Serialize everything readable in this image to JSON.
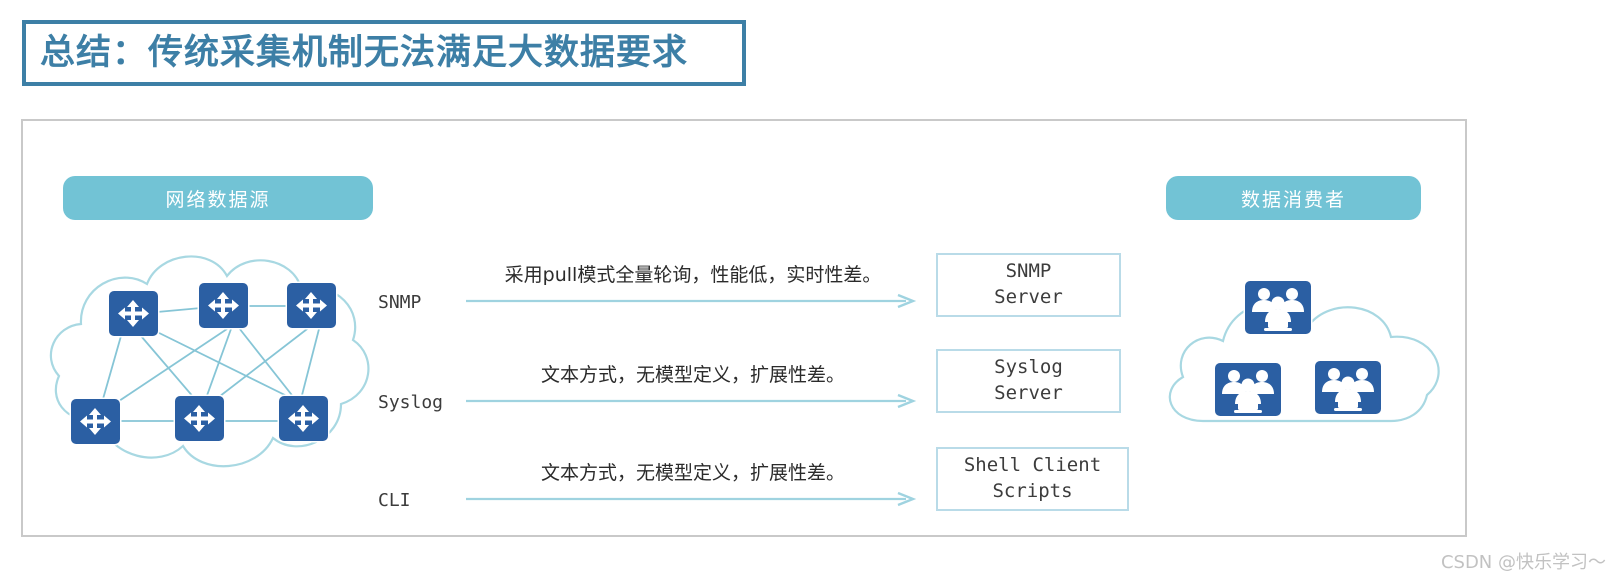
{
  "title": {
    "text": "总结：传统采集机制无法满足大数据要求"
  },
  "colors": {
    "title_accent": "#3d7fa6",
    "pill": "#72c3d5",
    "node_blue": "#2b5fa3",
    "cloud_outline": "#a8d8e2",
    "box_border": "#b9dbe8",
    "frame_border": "#c9c9c9",
    "arrow": "#9fd3e0"
  },
  "diagram": {
    "source_pill_label": "网络数据源",
    "consumer_pill_label": "数据消费者",
    "left_cloud_name": "network-cloud",
    "right_cloud_name": "consumer-cloud",
    "switch_count": 6,
    "user_group_count": 3,
    "flows": [
      {
        "protocol": "SNMP",
        "description": "采用pull模式全量轮询，性能低，实时性差。",
        "target_line1": "SNMP",
        "target_line2": "Server"
      },
      {
        "protocol": "Syslog",
        "description": "文本方式，无模型定义，扩展性差。",
        "target_line1": "Syslog",
        "target_line2": "Server"
      },
      {
        "protocol": "CLI",
        "description": "文本方式，无模型定义，扩展性差。",
        "target_line1": "Shell Client",
        "target_line2": "Scripts"
      }
    ]
  },
  "watermark": {
    "text": "CSDN @快乐学习～"
  }
}
